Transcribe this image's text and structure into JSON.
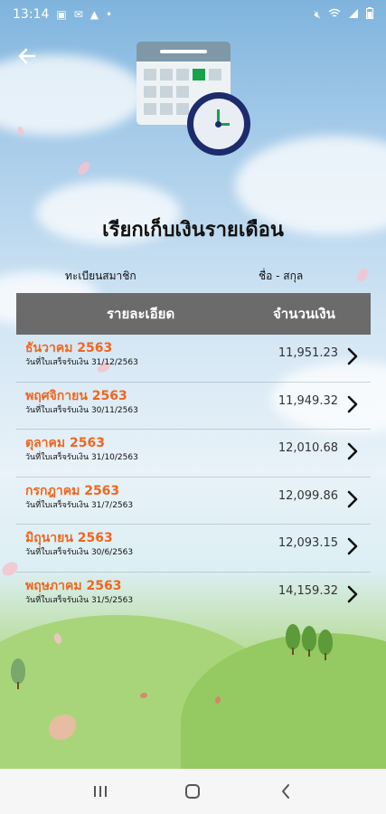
{
  "status_bar": {
    "time": "13:14",
    "left_icons": [
      "image-icon",
      "mail-icon",
      "alert-icon",
      "dot-icon"
    ],
    "right_icons": [
      "mute-icon",
      "wifi-icon",
      "signal-icon",
      "battery-icon"
    ]
  },
  "header": {
    "title": "เรียกเก็บเงินรายเดือน"
  },
  "member": {
    "registration_label": "ทะเบียนสมาชิก",
    "name_label": "ชื่อ - สกุล"
  },
  "table": {
    "col_detail": "รายละเอียด",
    "col_amount": "จำนวนเงิน",
    "rows": [
      {
        "month": "ธันวาคม 2563",
        "date": "วันที่ใบเสร็จรับเงิน 31/12/2563",
        "amount": "11,951.23"
      },
      {
        "month": "พฤศจิกายน 2563",
        "date": "วันที่ใบเสร็จรับเงิน 30/11/2563",
        "amount": "11,949.32"
      },
      {
        "month": "ตุลาคม 2563",
        "date": "วันที่ใบเสร็จรับเงิน 31/10/2563",
        "amount": "12,010.68"
      },
      {
        "month": "กรกฎาคม 2563",
        "date": "วันที่ใบเสร็จรับเงิน 31/7/2563",
        "amount": "12,099.86"
      },
      {
        "month": "มิถุนายน 2563",
        "date": "วันที่ใบเสร็จรับเงิน 30/6/2563",
        "amount": "12,093.15"
      },
      {
        "month": "พฤษภาคม 2563",
        "date": "วันที่ใบเสร็จรับเงิน 31/5/2563",
        "amount": "14,159.32"
      }
    ]
  },
  "colors": {
    "month_text": "#f0661e",
    "table_header_bg": "#6b6b6b",
    "clock_ring": "#1c2b6b",
    "calendar_highlight": "#16a34a"
  }
}
